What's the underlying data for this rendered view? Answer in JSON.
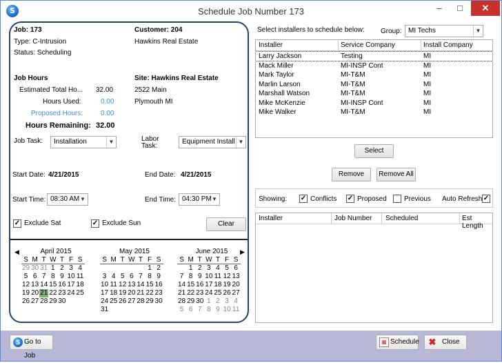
{
  "window": {
    "title": "Schedule Job Number 173",
    "app_icon": "S",
    "min": "–",
    "max": "□",
    "close": "✕"
  },
  "job": {
    "job_label": "Job: 173",
    "type": "Type: C-Intrusion",
    "status": "Status: Scheduling",
    "customer_label": "Customer: 204",
    "customer_name": "Hawkins Real Estate",
    "hours_title": "Job Hours",
    "est_label": "Estimated Total Ho...",
    "est_value": "32.00",
    "used_label": "Hours Used:",
    "used_value": "0.00",
    "proposed_label": "Proposed Hours:",
    "proposed_value": "0.00",
    "remaining_label": "Hours Remaining:",
    "remaining_value": "32.00",
    "site_label": "Site: Hawkins Real Estate",
    "site_addr1": "2522 Main",
    "site_addr2": "Plymouth MI"
  },
  "task": {
    "job_task_label": "Job Task:",
    "job_task_value": "Installation",
    "labor_task_label_1": "Labor",
    "labor_task_label_2": "Task:",
    "labor_task_value": "Equipment Install"
  },
  "dates": {
    "start_date_label": "Start Date:",
    "start_date_value": "4/21/2015",
    "end_date_label": "End Date:",
    "end_date_value": "4/21/2015",
    "start_time_label": "Start Time:",
    "start_time_value": "08:30 AM",
    "end_time_label": "End Time:",
    "end_time_value": "04:30 PM",
    "exclude_sat": "Exclude Sat",
    "exclude_sun": "Exclude Sun",
    "clear": "Clear"
  },
  "calendar": {
    "prev": "◀",
    "next": "▶",
    "dow": [
      "S",
      "M",
      "T",
      "W",
      "T",
      "F",
      "S"
    ],
    "months": [
      {
        "title": "April 2015",
        "days": [
          "29",
          "30",
          "31",
          "1",
          "2",
          "3",
          "4",
          "5",
          "6",
          "7",
          "8",
          "9",
          "10",
          "11",
          "12",
          "13",
          "14",
          "15",
          "16",
          "17",
          "18",
          "19",
          "20",
          "21",
          "22",
          "23",
          "24",
          "25",
          "26",
          "27",
          "28",
          "29",
          "30"
        ],
        "other_start": 3,
        "other_end": 0,
        "today_index": 23
      },
      {
        "title": "May 2015",
        "days": [
          "",
          "",
          "",
          "",
          "",
          "1",
          "2",
          "3",
          "4",
          "5",
          "6",
          "7",
          "8",
          "9",
          "10",
          "11",
          "12",
          "13",
          "14",
          "15",
          "16",
          "17",
          "18",
          "19",
          "20",
          "21",
          "22",
          "23",
          "24",
          "25",
          "26",
          "27",
          "28",
          "29",
          "30",
          "31"
        ],
        "other_start": 0,
        "other_end": 0,
        "today_index": -1
      },
      {
        "title": "June 2015",
        "days": [
          "",
          "1",
          "2",
          "3",
          "4",
          "5",
          "6",
          "7",
          "8",
          "9",
          "10",
          "11",
          "12",
          "13",
          "14",
          "15",
          "16",
          "17",
          "18",
          "19",
          "20",
          "21",
          "22",
          "23",
          "24",
          "25",
          "26",
          "27",
          "28",
          "29",
          "30",
          "1",
          "2",
          "3",
          "4",
          "5",
          "6",
          "7",
          "8",
          "9",
          "10",
          "11"
        ],
        "other_start": 0,
        "other_end": 11,
        "today_index": -1
      }
    ]
  },
  "installers": {
    "prompt": "Select installers to schedule below:",
    "group_label": "Group:",
    "group_value": "MI Techs",
    "columns": [
      "Installer",
      "Service Company",
      "Install Company"
    ],
    "rows": [
      [
        "Larry Jackson",
        "Testing",
        "MI"
      ],
      [
        "Mack Miller",
        "MI-INSP Cont",
        "MI"
      ],
      [
        "Mark Taylor",
        "MI-T&M",
        "MI"
      ],
      [
        "Marlin Larson",
        "MI-T&M",
        "MI"
      ],
      [
        "Marshall Watson",
        "MI-T&M",
        "MI"
      ],
      [
        "Mike McKenzie",
        "MI-INSP Cont",
        "MI"
      ],
      [
        "Mike Walker",
        "MI-T&M",
        "MI"
      ]
    ],
    "select": "Select",
    "remove": "Remove",
    "remove_all": "Remove All"
  },
  "showing": {
    "label": "Showing:",
    "conflicts": "Conflicts",
    "proposed": "Proposed",
    "previous": "Previous",
    "auto_refresh": "Auto Refresh:",
    "check": "✓",
    "columns": [
      "Installer",
      "Job Number",
      "Scheduled",
      "Est Length"
    ]
  },
  "footer": {
    "go_to_job": "Go to Job",
    "schedule": "Schedule",
    "close": "Close"
  }
}
